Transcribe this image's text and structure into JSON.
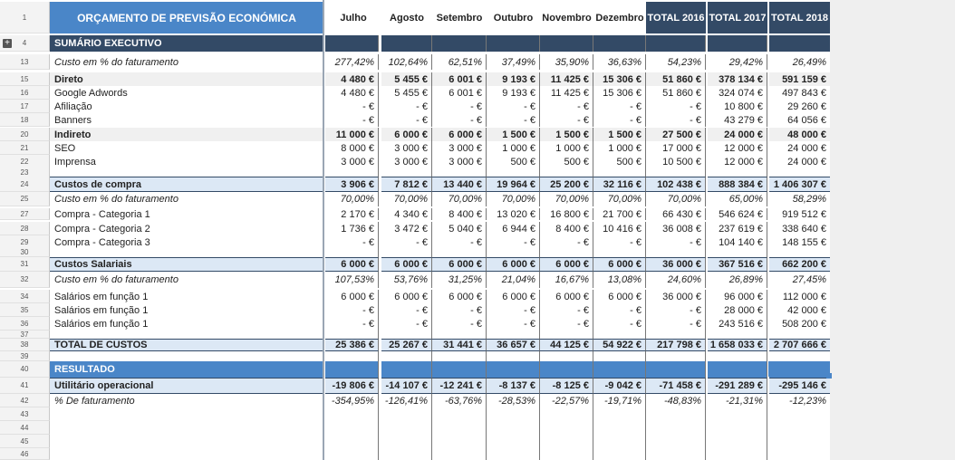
{
  "header": {
    "title": "ORÇAMENTO DE PREVISÃO ECONÓMICA",
    "months": [
      "Julho",
      "Agosto",
      "Setembro",
      "Outubro",
      "Novembro",
      "Dezembro"
    ],
    "totals": [
      "TOTAL 2016",
      "TOTAL 2017",
      "TOTAL 2018"
    ]
  },
  "colors": {
    "header_blue": "#4a86c8",
    "dark_band": "#334a66",
    "light_blue": "#dce8f5",
    "grey_row": "#f0f0f0"
  },
  "icons": {
    "group_toggle": "plus-icon"
  },
  "group_toggle_symbol": "+",
  "rows": [
    {
      "n": "4",
      "label": "SUMÁRIO EXECUTIVO",
      "style": "dark",
      "vals": [
        "",
        "",
        "",
        "",
        "",
        "",
        "",
        "",
        ""
      ]
    },
    {
      "n": "13",
      "label": "Custo em % do faturamento",
      "style": "ital",
      "vals": [
        "277,42%",
        "102,64%",
        "62,51%",
        "37,49%",
        "35,90%",
        "36,63%",
        "54,23%",
        "29,42%",
        "26,49%"
      ]
    },
    {
      "n": "15",
      "label": "Direto",
      "style": "greybold",
      "vals": [
        "4 480 €",
        "5 455 €",
        "6 001 €",
        "9 193 €",
        "11 425 €",
        "15 306 €",
        "51 860 €",
        "378 134 €",
        "591 159 €"
      ]
    },
    {
      "n": "16",
      "label": "Google Adwords",
      "style": "",
      "vals": [
        "4 480 €",
        "5 455 €",
        "6 001 €",
        "9 193 €",
        "11 425 €",
        "15 306 €",
        "51 860 €",
        "324 074 €",
        "497 843 €"
      ]
    },
    {
      "n": "17",
      "label": "Afiliação",
      "style": "",
      "vals": [
        "-   €",
        "-   €",
        "-   €",
        "-   €",
        "-   €",
        "-   €",
        "-   €",
        "10 800 €",
        "29 260 €"
      ]
    },
    {
      "n": "18",
      "label": "Banners",
      "style": "",
      "vals": [
        "-   €",
        "-   €",
        "-   €",
        "-   €",
        "-   €",
        "-   €",
        "-   €",
        "43 279 €",
        "64 056 €"
      ]
    },
    {
      "n": "20",
      "label": "Indireto",
      "style": "greybold",
      "vals": [
        "11 000 €",
        "6 000 €",
        "6 000 €",
        "1 500 €",
        "1 500 €",
        "1 500 €",
        "27 500 €",
        "24 000 €",
        "48 000 €"
      ]
    },
    {
      "n": "21",
      "label": "SEO",
      "style": "",
      "vals": [
        "8 000 €",
        "3 000 €",
        "3 000 €",
        "1 000 €",
        "1 000 €",
        "1 000 €",
        "17 000 €",
        "12 000 €",
        "24 000 €"
      ]
    },
    {
      "n": "22",
      "label": "Imprensa",
      "style": "",
      "vals": [
        "3 000 €",
        "3 000 €",
        "3 000 €",
        "500 €",
        "500 €",
        "500 €",
        "10 500 €",
        "12 000 €",
        "24 000 €"
      ]
    },
    {
      "n": "23",
      "label": "",
      "style": "",
      "vals": [
        "",
        "",
        "",
        "",
        "",
        "",
        "",
        "",
        ""
      ]
    },
    {
      "n": "24",
      "label": "Custos de compra",
      "style": "lightbold",
      "vals": [
        "3 906 €",
        "7 812 €",
        "13 440 €",
        "19 964 €",
        "25 200 €",
        "32 116 €",
        "102 438 €",
        "888 384 €",
        "1 406 307 €"
      ]
    },
    {
      "n": "25",
      "label": "Custo em % do faturamento",
      "style": "ital",
      "vals": [
        "70,00%",
        "70,00%",
        "70,00%",
        "70,00%",
        "70,00%",
        "70,00%",
        "70,00%",
        "65,00%",
        "58,29%"
      ]
    },
    {
      "n": "27",
      "label": "Compra - Categoria 1",
      "style": "",
      "vals": [
        "2 170 €",
        "4 340 €",
        "8 400 €",
        "13 020 €",
        "16 800 €",
        "21 700 €",
        "66 430 €",
        "546 624 €",
        "919 512 €"
      ]
    },
    {
      "n": "28",
      "label": "Compra - Categoria 2",
      "style": "",
      "vals": [
        "1 736 €",
        "3 472 €",
        "5 040 €",
        "6 944 €",
        "8 400 €",
        "10 416 €",
        "36 008 €",
        "237 619 €",
        "338 640 €"
      ]
    },
    {
      "n": "29",
      "label": "Compra - Categoria 3",
      "style": "",
      "vals": [
        "-   €",
        "-   €",
        "-   €",
        "-   €",
        "-   €",
        "-   €",
        "-   €",
        "104 140 €",
        "148 155 €"
      ]
    },
    {
      "n": "30",
      "label": "",
      "style": "",
      "vals": [
        "",
        "",
        "",
        "",
        "",
        "",
        "",
        "",
        ""
      ]
    },
    {
      "n": "31",
      "label": "Custos Salariais",
      "style": "lightbold",
      "vals": [
        "6 000 €",
        "6 000 €",
        "6 000 €",
        "6 000 €",
        "6 000 €",
        "6 000 €",
        "36 000 €",
        "367 516 €",
        "662 200 €"
      ]
    },
    {
      "n": "32",
      "label": "Custo em % do faturamento",
      "style": "ital",
      "vals": [
        "107,53%",
        "53,76%",
        "31,25%",
        "21,04%",
        "16,67%",
        "13,08%",
        "24,60%",
        "26,89%",
        "27,45%"
      ]
    },
    {
      "n": "34",
      "label": "Salários em função 1",
      "style": "",
      "vals": [
        "6 000 €",
        "6 000 €",
        "6 000 €",
        "6 000 €",
        "6 000 €",
        "6 000 €",
        "36 000 €",
        "96 000 €",
        "112 000 €"
      ]
    },
    {
      "n": "35",
      "label": "Salários em função 1",
      "style": "",
      "vals": [
        "-   €",
        "-   €",
        "-   €",
        "-   €",
        "-   €",
        "-   €",
        "-   €",
        "28 000 €",
        "42 000 €"
      ]
    },
    {
      "n": "36",
      "label": "Salários em função 1",
      "style": "",
      "vals": [
        "-   €",
        "-   €",
        "-   €",
        "-   €",
        "-   €",
        "-   €",
        "-   €",
        "243 516 €",
        "508 200 €"
      ]
    },
    {
      "n": "37",
      "label": "",
      "style": "",
      "vals": [
        "",
        "",
        "",
        "",
        "",
        "",
        "",
        "",
        ""
      ]
    },
    {
      "n": "38",
      "label": "TOTAL DE CUSTOS",
      "style": "lightbold",
      "vals": [
        "25 386 €",
        "25 267 €",
        "31 441 €",
        "36 657 €",
        "44 125 €",
        "54 922 €",
        "217 798 €",
        "1 658 033 €",
        "2 707 666 €"
      ]
    },
    {
      "n": "39",
      "label": "",
      "style": "",
      "vals": [
        "",
        "",
        "",
        "",
        "",
        "",
        "",
        "",
        ""
      ]
    },
    {
      "n": "40",
      "label": "RESULTADO",
      "style": "blue",
      "vals": [
        "",
        "",
        "",
        "",
        "",
        "",
        "",
        "",
        ""
      ]
    },
    {
      "n": "41",
      "label": "Utilitário operacional",
      "style": "lightbold",
      "vals": [
        "-19 806 €",
        "-14 107 €",
        "-12 241 €",
        "-8 137 €",
        "-8 125 €",
        "-9 042 €",
        "-71 458 €",
        "-291 289 €",
        "-295 146 €"
      ]
    },
    {
      "n": "42",
      "label": "% De faturamento",
      "style": "ital",
      "vals": [
        "-354,95%",
        "-126,41%",
        "-63,76%",
        "-28,53%",
        "-22,57%",
        "-19,71%",
        "-48,83%",
        "-21,31%",
        "-12,23%"
      ]
    },
    {
      "n": "43",
      "label": "",
      "style": "",
      "vals": [
        "",
        "",
        "",
        "",
        "",
        "",
        "",
        "",
        ""
      ]
    },
    {
      "n": "44",
      "label": "",
      "style": "",
      "vals": [
        "",
        "",
        "",
        "",
        "",
        "",
        "",
        "",
        ""
      ]
    },
    {
      "n": "45",
      "label": "",
      "style": "",
      "vals": [
        "",
        "",
        "",
        "",
        "",
        "",
        "",
        "",
        ""
      ]
    },
    {
      "n": "46",
      "label": "",
      "style": "",
      "vals": [
        "",
        "",
        "",
        "",
        "",
        "",
        "",
        "",
        ""
      ]
    }
  ]
}
